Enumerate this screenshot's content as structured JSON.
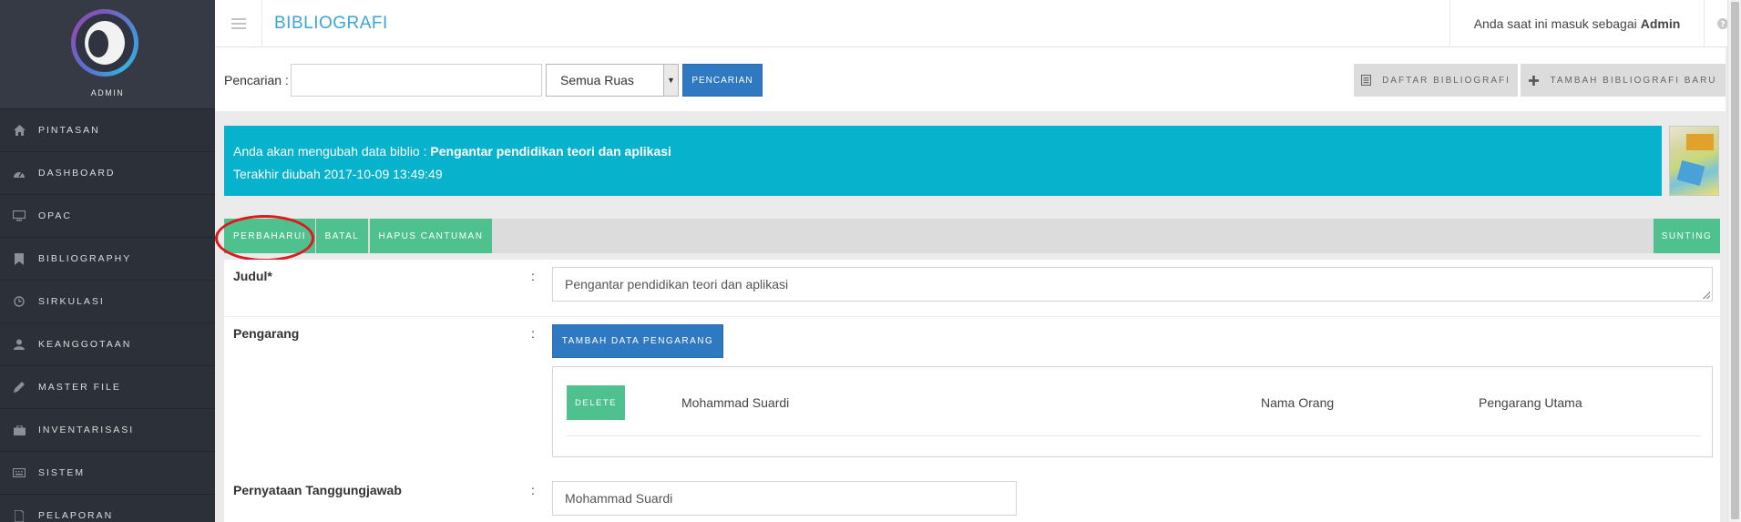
{
  "sidebar": {
    "role": "ADMIN",
    "items": [
      {
        "label": "PINTASAN",
        "icon": "home-icon"
      },
      {
        "label": "DASHBOARD",
        "icon": "dashboard-icon"
      },
      {
        "label": "OPAC",
        "icon": "monitor-icon"
      },
      {
        "label": "BIBLIOGRAPHY",
        "icon": "bookmark-icon"
      },
      {
        "label": "SIRKULASI",
        "icon": "clock-icon"
      },
      {
        "label": "KEANGGOTAAN",
        "icon": "user-icon"
      },
      {
        "label": "MASTER FILE",
        "icon": "pencil-icon"
      },
      {
        "label": "INVENTARISASI",
        "icon": "briefcase-icon"
      },
      {
        "label": "SISTEM",
        "icon": "keyboard-icon"
      },
      {
        "label": "PELAPORAN",
        "icon": "file-icon"
      }
    ]
  },
  "header": {
    "title": "BIBLIOGRAFI",
    "user_prefix": "Anda saat ini masuk sebagai",
    "user_name": "Admin"
  },
  "search": {
    "label": "Pencarian :",
    "value": "",
    "field_select": "Semua Ruas",
    "search_button": "PENCARIAN",
    "list_button": "DAFTAR BIBLIOGRAFI",
    "add_button": "TAMBAH BIBLIOGRAFI BARU"
  },
  "banner": {
    "edit_prefix": "Anda akan mengubah data biblio :",
    "edit_title": "Pengantar pendidikan teori dan aplikasi",
    "last_modified": "Terakhir diubah 2017-10-09 13:49:49"
  },
  "actions": {
    "update": "PERBAHARUI",
    "cancel": "BATAL",
    "delete_record": "HAPUS CANTUMAN",
    "edit": "SUNTING"
  },
  "form": {
    "colon": ":",
    "title_label": "Judul*",
    "title_value": "Pengantar pendidikan teori dan aplikasi",
    "author_label": "Pengarang",
    "add_author_button": "TAMBAH DATA PENGARANG",
    "authors": [
      {
        "delete_label": "DELETE",
        "name": "Mohammad Suardi",
        "type": "Nama Orang",
        "role": "Pengarang Utama"
      }
    ],
    "responsibility_label": "Pernyataan Tanggungjawab",
    "responsibility_value": "Mohammad Suardi"
  },
  "colors": {
    "sidebar_bg": "#2c3039",
    "title_blue": "#3aa6d8",
    "button_blue": "#2f78c2",
    "banner_cyan": "#07b2cd",
    "button_green": "#4fc18f",
    "highlight_red": "#e0181e"
  }
}
